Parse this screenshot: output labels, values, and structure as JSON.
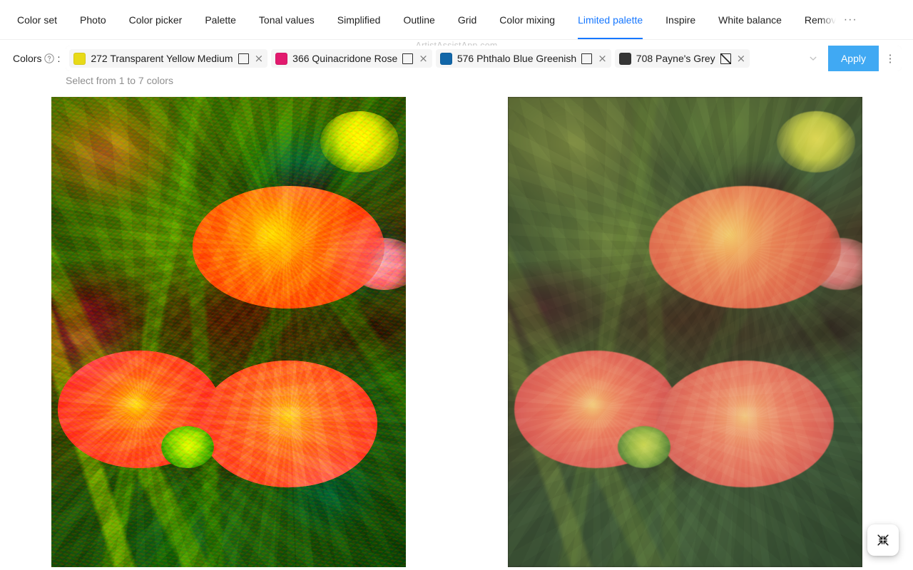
{
  "tabs": [
    {
      "label": "Color set",
      "active": false
    },
    {
      "label": "Photo",
      "active": false
    },
    {
      "label": "Color picker",
      "active": false
    },
    {
      "label": "Palette",
      "active": false
    },
    {
      "label": "Tonal values",
      "active": false
    },
    {
      "label": "Simplified",
      "active": false
    },
    {
      "label": "Outline",
      "active": false
    },
    {
      "label": "Grid",
      "active": false
    },
    {
      "label": "Color mixing",
      "active": false
    },
    {
      "label": "Limited palette",
      "active": true
    },
    {
      "label": "Inspire",
      "active": false
    },
    {
      "label": "White balance",
      "active": false
    },
    {
      "label": "Remov",
      "active": false
    }
  ],
  "tabbar": {
    "overflow_label": "···"
  },
  "watermark": {
    "text": "ArtistAssistApp.com"
  },
  "toolbar": {
    "colors_label": "Colors",
    "help_icon": "question-circle-icon",
    "colon": ":",
    "apply_label": "Apply",
    "more_label": "⋮",
    "hint": "Select from 1 to 7 colors",
    "chips": [
      {
        "code": "272",
        "name": "272 Transparent Yellow Medium",
        "swatch": "#e8da18",
        "checkbox_state": "unchecked",
        "close_label": "×"
      },
      {
        "code": "366",
        "name": "366 Quinacridone Rose",
        "swatch": "#e21a6e",
        "checkbox_state": "unchecked",
        "close_label": "×"
      },
      {
        "code": "576",
        "name": "576 Phthalo Blue Greenish",
        "swatch": "#1166a8",
        "checkbox_state": "unchecked",
        "close_label": "×"
      },
      {
        "code": "708",
        "name": "708 Payne's Grey",
        "swatch": "#353535",
        "checkbox_state": "partial",
        "close_label": "×"
      }
    ]
  },
  "panels": [
    {
      "name": "limited-palette-result-image",
      "alt": "Dahlia flowers rendered with limited palette"
    },
    {
      "name": "original-photo-image",
      "alt": "Original photo of dahlia flowers"
    }
  ],
  "fab": {
    "icon": "collapse-arrows-icon"
  },
  "colors": {
    "accent": "#1677ff",
    "apply_button": "#40a9f3",
    "text_primary": "rgba(0,0,0,0.88)",
    "text_secondary": "rgba(0,0,0,0.45)"
  }
}
